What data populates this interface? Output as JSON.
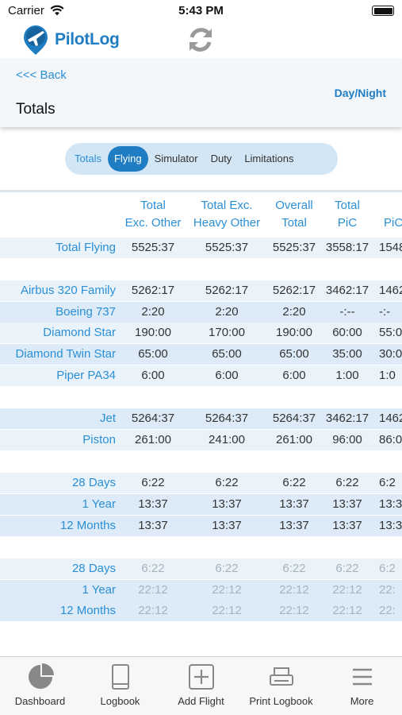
{
  "status_bar": {
    "carrier": "Carrier",
    "time": "5:43 PM"
  },
  "brand": {
    "app_name": "PilotLog",
    "accent": "#1f7dc4"
  },
  "header": {
    "back_label": "<<< Back",
    "title": "Totals",
    "mode_toggle": "Day/Night"
  },
  "segments": {
    "items": [
      "Totals",
      "Flying",
      "Simulator",
      "Duty",
      "Limitations"
    ],
    "selected": "Flying"
  },
  "table": {
    "columns": [
      {
        "line1": "Total",
        "line2": "Exc. Other"
      },
      {
        "line1": "Total Exc.",
        "line2": "Heavy Other"
      },
      {
        "line1": "Overall",
        "line2": "Total"
      },
      {
        "line1": "Total",
        "line2": "PiC"
      },
      {
        "line1": "PiC",
        "line2": ""
      }
    ],
    "rows": [
      {
        "label": "Total Flying",
        "values": [
          "5525:37",
          "5525:37",
          "5525:37",
          "3558:17",
          "1548"
        ]
      },
      {
        "label": "Airbus 320 Family",
        "values": [
          "5262:17",
          "5262:17",
          "5262:17",
          "3462:17",
          "1462"
        ]
      },
      {
        "label": "Boeing 737",
        "values": [
          "2:20",
          "2:20",
          "2:20",
          "-:--",
          "-:-"
        ]
      },
      {
        "label": "Diamond Star",
        "values": [
          "190:00",
          "170:00",
          "190:00",
          "60:00",
          "55:0"
        ]
      },
      {
        "label": "Diamond Twin Star",
        "values": [
          "65:00",
          "65:00",
          "65:00",
          "35:00",
          "30:0"
        ]
      },
      {
        "label": "Piper PA34",
        "values": [
          "6:00",
          "6:00",
          "6:00",
          "1:00",
          "1:0"
        ]
      },
      {
        "label": "Jet",
        "values": [
          "5264:37",
          "5264:37",
          "5264:37",
          "3462:17",
          "1462"
        ]
      },
      {
        "label": "Piston",
        "values": [
          "261:00",
          "241:00",
          "261:00",
          "96:00",
          "86:0"
        ]
      },
      {
        "label": "28 Days",
        "values": [
          "6:22",
          "6:22",
          "6:22",
          "6:22",
          "6:2"
        ]
      },
      {
        "label": "1 Year",
        "values": [
          "13:37",
          "13:37",
          "13:37",
          "13:37",
          "13:3"
        ]
      },
      {
        "label": "12 Months",
        "values": [
          "13:37",
          "13:37",
          "13:37",
          "13:37",
          "13:3"
        ]
      },
      {
        "label": "28 Days",
        "values": [
          "6:22",
          "6:22",
          "6:22",
          "6:22",
          "6:2"
        ]
      },
      {
        "label": "1 Year",
        "values": [
          "22:12",
          "22:12",
          "22:12",
          "22:12",
          "22:"
        ]
      },
      {
        "label": "12 Months",
        "values": [
          "22:12",
          "22:12",
          "22:12",
          "22:12",
          "22:"
        ]
      }
    ]
  },
  "tab_bar": {
    "items": [
      {
        "label": "Dashboard",
        "icon": "pie-chart-icon"
      },
      {
        "label": "Logbook",
        "icon": "book-icon"
      },
      {
        "label": "Add Flight",
        "icon": "add-square-icon"
      },
      {
        "label": "Print Logbook",
        "icon": "printer-icon"
      },
      {
        "label": "More",
        "icon": "hamburger-icon"
      }
    ]
  }
}
